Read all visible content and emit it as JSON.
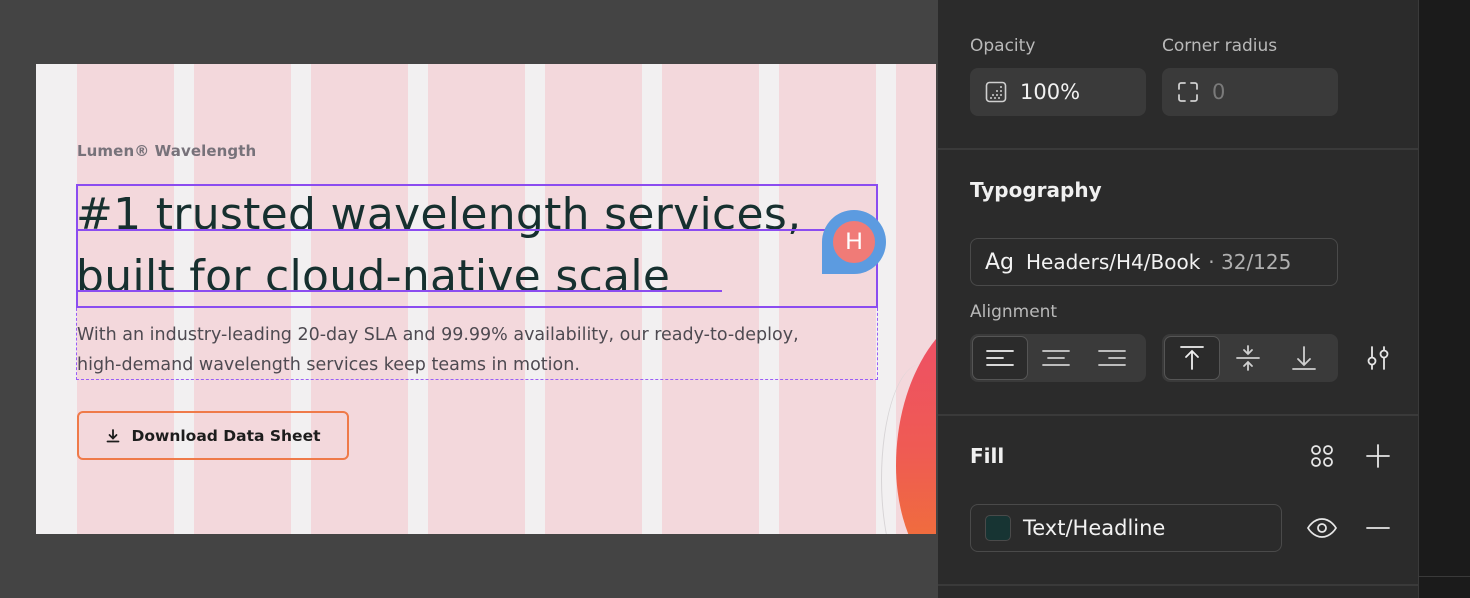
{
  "canvas": {
    "eyebrow": "Lumen® Wavelength",
    "headline_line1": "#1 trusted wavelength services,",
    "headline_line2": "built for cloud-native scale",
    "body": "With an industry-leading 20-day SLA and 99.99% availability, our ready-to-deploy, high-demand wavelength services keep teams in motion.",
    "cta_label": "Download Data Sheet",
    "cta_icon": "download-icon",
    "collaborator_initial": "H"
  },
  "panel": {
    "opacity_label": "Opacity",
    "opacity_value": "100%",
    "corner_radius_label": "Corner radius",
    "corner_radius_value": "0",
    "typography_title": "Typography",
    "type_style_prefix": "Ag",
    "type_style_name": "Headers/H4/Book",
    "type_style_size": "· 32/125",
    "alignment_label": "Alignment",
    "fill_title": "Fill",
    "fill_style_name": "Text/Headline",
    "fill_swatch_color": "#173433"
  },
  "colors": {
    "accent_purple": "#8b4cf0",
    "cta_border": "#ef7a49",
    "column_pink": "#f3d8dc",
    "avatar_bg": "#f07b77",
    "avatar_ring": "#5c9be0"
  }
}
